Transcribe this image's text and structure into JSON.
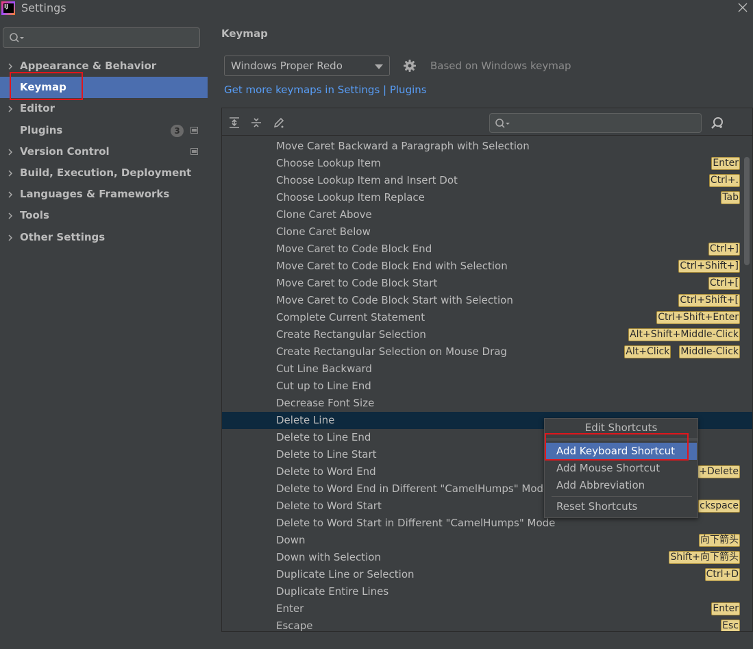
{
  "window": {
    "title": "Settings"
  },
  "sidebar": {
    "search_placeholder": "",
    "items": [
      {
        "label": "Appearance & Behavior",
        "expandable": true
      },
      {
        "label": "Keymap",
        "expandable": false,
        "selected": true
      },
      {
        "label": "Editor",
        "expandable": true
      },
      {
        "label": "Plugins",
        "expandable": false,
        "badge": "3"
      },
      {
        "label": "Version Control",
        "expandable": true
      },
      {
        "label": "Build, Execution, Deployment",
        "expandable": true
      },
      {
        "label": "Languages & Frameworks",
        "expandable": true
      },
      {
        "label": "Tools",
        "expandable": true
      },
      {
        "label": "Other Settings",
        "expandable": true
      }
    ]
  },
  "main": {
    "heading": "Keymap",
    "keymap_select": "Windows Proper Redo",
    "based_on": "Based on Windows keymap",
    "link": "Get more keymaps in Settings | Plugins",
    "filter_placeholder": ""
  },
  "actions": [
    {
      "name": "Move Caret Backward a Paragraph with Selection",
      "keys": []
    },
    {
      "name": "Choose Lookup Item",
      "keys": [
        "Enter"
      ]
    },
    {
      "name": "Choose Lookup Item and Insert Dot",
      "keys": [
        "Ctrl+."
      ]
    },
    {
      "name": "Choose Lookup Item Replace",
      "keys": [
        "Tab"
      ]
    },
    {
      "name": "Clone Caret Above",
      "keys": []
    },
    {
      "name": "Clone Caret Below",
      "keys": []
    },
    {
      "name": "Move Caret to Code Block End",
      "keys": [
        "Ctrl+]"
      ]
    },
    {
      "name": "Move Caret to Code Block End with Selection",
      "keys": [
        "Ctrl+Shift+]"
      ]
    },
    {
      "name": "Move Caret to Code Block Start",
      "keys": [
        "Ctrl+["
      ]
    },
    {
      "name": "Move Caret to Code Block Start with Selection",
      "keys": [
        "Ctrl+Shift+["
      ]
    },
    {
      "name": "Complete Current Statement",
      "keys": [
        "Ctrl+Shift+Enter"
      ]
    },
    {
      "name": "Create Rectangular Selection",
      "keys": [
        "Alt+Shift+Middle-Click"
      ]
    },
    {
      "name": "Create Rectangular Selection on Mouse Drag",
      "keys": [
        "Alt+Click",
        "Middle-Click"
      ]
    },
    {
      "name": "Cut Line Backward",
      "keys": []
    },
    {
      "name": "Cut up to Line End",
      "keys": []
    },
    {
      "name": "Decrease Font Size",
      "keys": []
    },
    {
      "name": "Delete Line",
      "keys": [],
      "selected": true
    },
    {
      "name": "Delete to Line End",
      "keys": []
    },
    {
      "name": "Delete to Line Start",
      "keys": []
    },
    {
      "name": "Delete to Word End",
      "keys": [
        "+Delete"
      ]
    },
    {
      "name": "Delete to Word End in Different \"CamelHumps\" Mode",
      "keys": []
    },
    {
      "name": "Delete to Word Start",
      "keys": [
        "ckspace"
      ]
    },
    {
      "name": "Delete to Word Start in Different \"CamelHumps\" Mode",
      "keys": []
    },
    {
      "name": "Down",
      "keys": [
        "向下箭头"
      ]
    },
    {
      "name": "Down with Selection",
      "keys": [
        "Shift+向下箭头"
      ]
    },
    {
      "name": "Duplicate Line or Selection",
      "keys": [
        "Ctrl+D"
      ]
    },
    {
      "name": "Duplicate Entire Lines",
      "keys": []
    },
    {
      "name": "Enter",
      "keys": [
        "Enter"
      ]
    },
    {
      "name": "Escape",
      "keys": [
        "Esc"
      ]
    }
  ],
  "context_menu": {
    "header": "Edit Shortcuts",
    "items": [
      "Add Keyboard Shortcut",
      "Add Mouse Shortcut",
      "Add Abbreviation",
      "Reset Shortcuts"
    ],
    "highlighted": "Add Keyboard Shortcut"
  },
  "colors": {
    "background": "#3c3f41",
    "selection": "#4b6eaf",
    "row_selection": "#0d293e",
    "link": "#589df6",
    "shortcut_badge": "#e8d28a",
    "annotation_red": "#e0161c"
  }
}
